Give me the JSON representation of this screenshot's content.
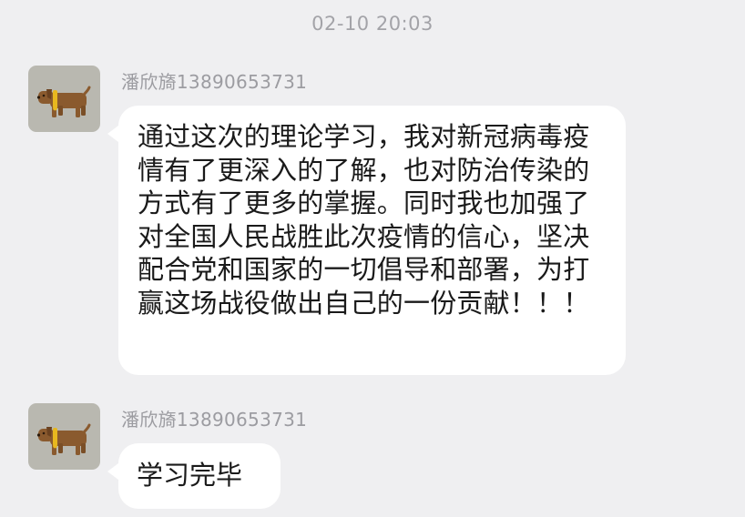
{
  "chat": {
    "timestamp": "02-10 20:03",
    "messages": [
      {
        "sender": "潘欣旖13890653731",
        "avatar_icon": "dog-avatar-icon",
        "text": "通过这次的理论学习，我对新冠病毒疫情有了更深入的了解，也对防治传染的方式有了更多的掌握。同时我也加强了对全国人民战胜此次疫情的信心，坚决配合党和国家的一切倡导和部署，为打赢这场战役做出自己的一份贡献！！！"
      },
      {
        "sender": "潘欣旖13890653731",
        "avatar_icon": "dog-avatar-icon",
        "text": "学习完毕"
      }
    ]
  },
  "colors": {
    "background": "#efeff1",
    "bubble": "#ffffff",
    "sender_text": "#9c9ca1",
    "message_text": "#1a1a1a",
    "dog_body": "#8a5a2e",
    "dog_collar": "#e8b81f"
  }
}
